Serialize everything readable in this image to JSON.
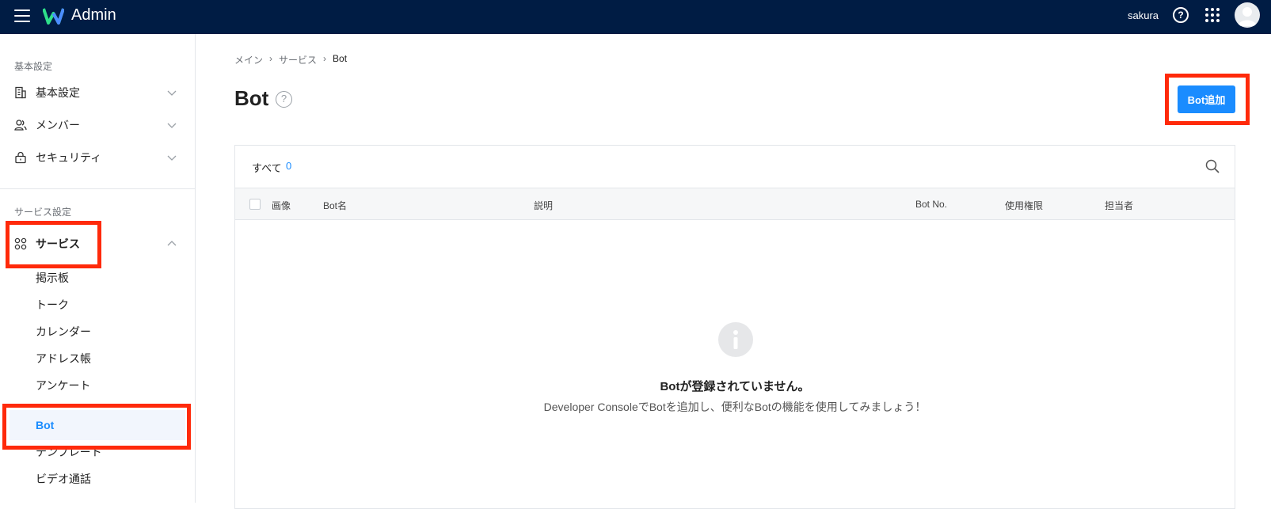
{
  "topbar": {
    "app_title": "Admin",
    "user_name": "sakura",
    "help_glyph": "?",
    "icons": [
      "menu-icon",
      "logo-icon",
      "help-icon",
      "apps-grid-icon",
      "avatar"
    ]
  },
  "sidebar": {
    "section_basic": "基本設定",
    "basic_items": [
      {
        "label": "基本設定",
        "icon": "building-icon"
      },
      {
        "label": "メンバー",
        "icon": "members-icon"
      },
      {
        "label": "セキュリティ",
        "icon": "lock-icon"
      }
    ],
    "section_service": "サービス設定",
    "service_group": {
      "label": "サービス",
      "icon": "grid-icon",
      "expanded": true
    },
    "service_items": [
      "掲示板",
      "トーク",
      "カレンダー",
      "アドレス帳",
      "アンケート",
      "Bot",
      "テンプレート",
      "ビデオ通話"
    ],
    "active_item": "Bot"
  },
  "breadcrumb": [
    "メイン",
    "サービス",
    "Bot"
  ],
  "breadcrumb_sep": "›",
  "page": {
    "title": "Bot",
    "help_glyph": "?",
    "add_button": "Bot追加"
  },
  "table": {
    "all_label": "すべて",
    "all_count": "0",
    "headers": [
      "画像",
      "Bot名",
      "説明",
      "Bot No.",
      "使用権限",
      "担当者"
    ]
  },
  "empty_state": {
    "icon": "info-icon",
    "title": "Botが登録されていません。",
    "subtitle": "Developer ConsoleでBotを追加し、便利なBotの機能を使用してみましょう！"
  },
  "colors": {
    "topbar": "#001c44",
    "accent": "#1a8cff",
    "highlight": "#ff2a0a"
  }
}
